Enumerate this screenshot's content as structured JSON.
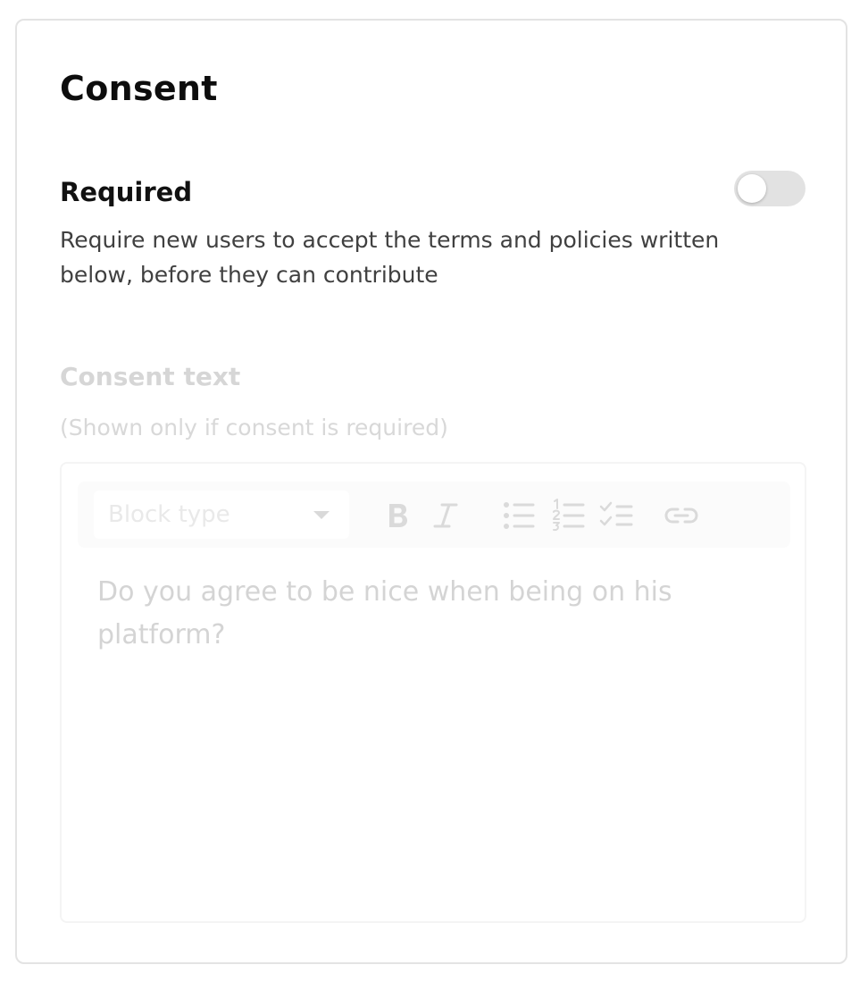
{
  "section": {
    "title": "Consent"
  },
  "required": {
    "label": "Required",
    "description": "Require new users to accept the terms and policies written below, before they can contribute",
    "toggle_on": false
  },
  "consent_text": {
    "label": "Consent text",
    "hint": "(Shown only if consent is required)",
    "content": "Do you agree to be nice when being on his platform?"
  },
  "toolbar": {
    "block_type_placeholder": "Block type",
    "icons": [
      "chevron-down-icon",
      "bold-icon",
      "italic-icon",
      "bullet-list-icon",
      "numbered-list-icon",
      "checklist-icon",
      "link-icon"
    ]
  },
  "colors": {
    "toggle_off": "#e2e2e2",
    "border": "#e3e3e3",
    "disabled_text": "#d6d6d6"
  }
}
